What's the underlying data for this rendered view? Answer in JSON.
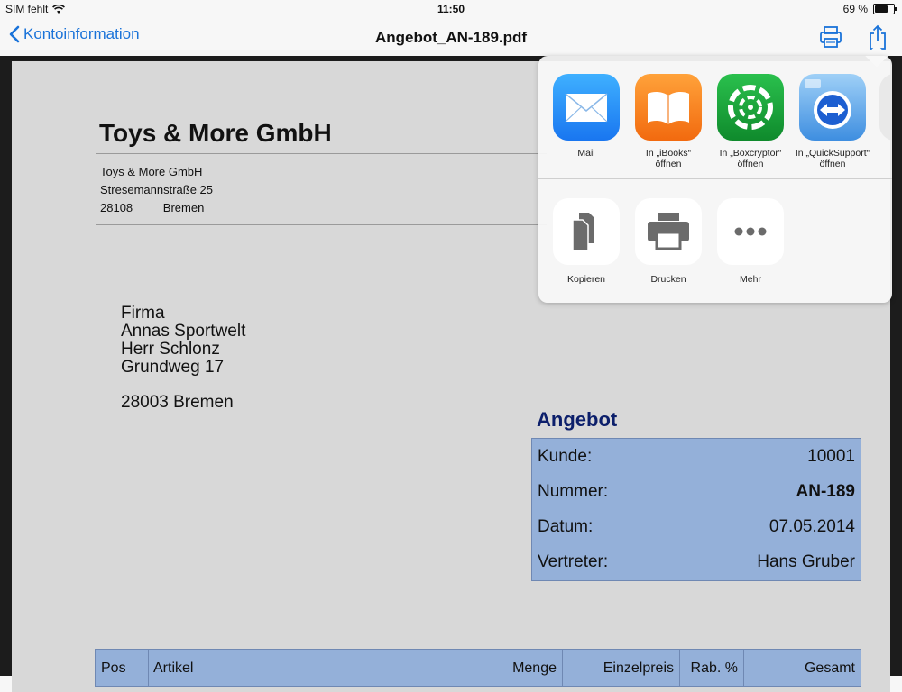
{
  "status": {
    "carrier": "SIM fehlt",
    "time": "11:50",
    "battery": "69 %",
    "battery_level": 0.69
  },
  "nav": {
    "back_label": "Kontoinformation",
    "title": "Angebot_AN-189.pdf",
    "print_icon": "printer-icon",
    "share_icon": "share-icon"
  },
  "document": {
    "company_title": "Toys & More GmbH",
    "company_address": {
      "name": "Toys & More GmbH",
      "street": "Stresemannstraße 25",
      "zip": "28108",
      "city": "Bremen"
    },
    "recipient": {
      "line1": "Firma",
      "line2": "Annas Sportwelt",
      "line3": "Herr Schlonz",
      "line4": "Grundweg 17",
      "line5": "28003 Bremen"
    },
    "offer": {
      "title": "Angebot",
      "rows": [
        {
          "label": "Kunde:",
          "value": "10001"
        },
        {
          "label": "Nummer:",
          "value": "AN-189"
        },
        {
          "label": "Datum:",
          "value": "07.05.2014"
        },
        {
          "label": "Vertreter:",
          "value": "Hans Gruber"
        }
      ]
    },
    "items_header": [
      "Pos",
      "Artikel",
      "Menge",
      "Einzelpreis",
      "Rab. %",
      "Gesamt"
    ]
  },
  "share_sheet": {
    "apps": [
      {
        "label_line1": "Mail",
        "label_line2": "",
        "icon": "mail-icon",
        "color": "#1d8cf8"
      },
      {
        "label_line1": "In „iBooks“",
        "label_line2": "öffnen",
        "icon": "ibooks-icon",
        "color": "#f57a17"
      },
      {
        "label_line1": "In „Boxcryptor“",
        "label_line2": "öffnen",
        "icon": "boxcryptor-icon",
        "color": "#18a33a"
      },
      {
        "label_line1": "In „QuickSupport“",
        "label_line2": "öffnen",
        "icon": "quicksupport-icon",
        "color": "#2a6fd6"
      }
    ],
    "actions": [
      {
        "label": "Kopieren",
        "icon": "copy-icon"
      },
      {
        "label": "Drucken",
        "icon": "print-icon"
      },
      {
        "label": "Mehr",
        "icon": "more-icon"
      }
    ]
  }
}
